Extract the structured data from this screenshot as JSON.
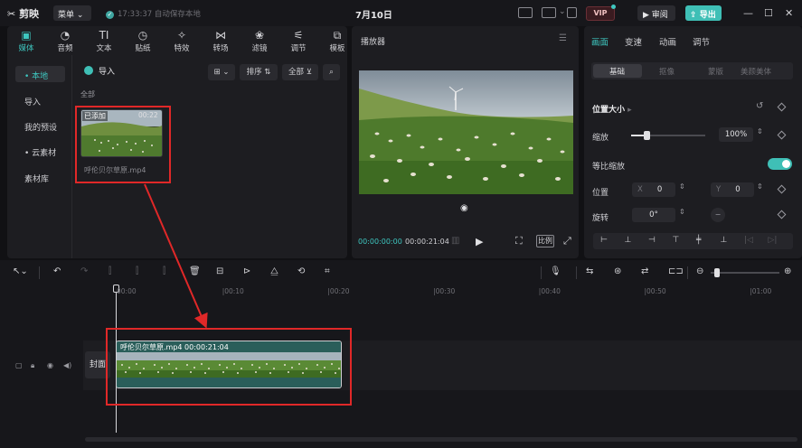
{
  "titlebar": {
    "logo": "剪映",
    "menu_label": "菜单",
    "save_status": "17:33:37 自动保存本地",
    "project_date": "7月10日",
    "vip_label": "VIP",
    "review_label": "审阅",
    "export_label": "导出"
  },
  "media_tools": [
    {
      "label": "媒体",
      "icon": "media-icon",
      "glyph": "▣",
      "active": true
    },
    {
      "label": "音频",
      "icon": "audio-icon",
      "glyph": "◔"
    },
    {
      "label": "文本",
      "icon": "text-icon",
      "glyph": "TI"
    },
    {
      "label": "贴纸",
      "icon": "sticker-icon",
      "glyph": "◷"
    },
    {
      "label": "特效",
      "icon": "effects-icon",
      "glyph": "✧"
    },
    {
      "label": "转场",
      "icon": "transition-icon",
      "glyph": "⋈"
    },
    {
      "label": "滤镜",
      "icon": "filter-icon",
      "glyph": "❀"
    },
    {
      "label": "调节",
      "icon": "adjust-icon",
      "glyph": "⚟"
    },
    {
      "label": "模板",
      "icon": "template-icon",
      "glyph": "⧉"
    }
  ],
  "sidebar": {
    "items": [
      {
        "label": "• 本地",
        "active": true
      },
      {
        "label": "导入"
      },
      {
        "label": "我的预设"
      },
      {
        "label": "• 云素材"
      },
      {
        "label": "素材库"
      }
    ]
  },
  "media": {
    "import_label": "导入",
    "sort_label": "排序",
    "filter_label": "全部",
    "section_label": "全部",
    "item": {
      "added_badge": "已添加",
      "duration": "00:22",
      "filename": "呼伦贝尔草原.mp4"
    }
  },
  "player": {
    "title": "播放器",
    "current_time": "00:00:00:00",
    "total_time": "00:00:21:04",
    "ratio_label": "比例"
  },
  "properties": {
    "tabs": [
      "画面",
      "变速",
      "动画",
      "调节"
    ],
    "subtabs": [
      "基础",
      "抠像",
      "蒙版",
      "美颜美体"
    ],
    "position_size_label": "位置大小",
    "scale_label": "缩放",
    "scale_value": "100%",
    "scale_fraction": 0.2,
    "uniform_scale_label": "等比缩放",
    "position_label": "位置",
    "x_label": "X",
    "x_value": "0",
    "y_label": "Y",
    "y_value": "0",
    "rotate_label": "旋转",
    "rotate_value": "0°"
  },
  "timeline": {
    "ruler_ticks": [
      "00:00",
      "|00:10",
      "|00:20",
      "|00:30",
      "|00:40",
      "|00:50",
      "|01:00"
    ],
    "cover_label": "封面",
    "clip_label": "呼伦贝尔草原.mp4  00:00:21:04"
  },
  "colors": {
    "accent": "#3ec7c0",
    "annotation": "#e02828",
    "export_bg": "#3fbfb6"
  }
}
